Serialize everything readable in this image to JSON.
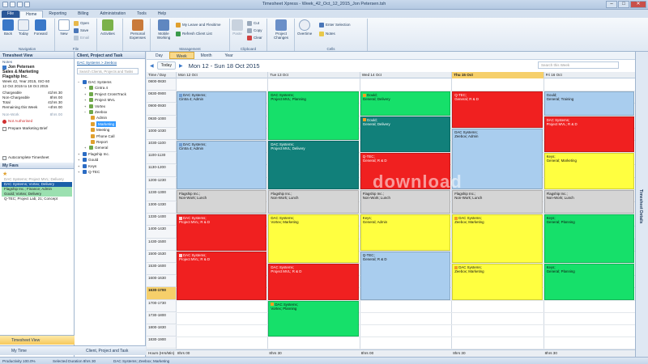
{
  "window": {
    "title": "Timesheet Xpress - Week_42_Oct_12_2015_Jon Petersen.tsh"
  },
  "tabs": [
    "File",
    "Home",
    "Reporting",
    "Billing",
    "Administration",
    "Tools",
    "Help"
  ],
  "ribbon": {
    "navigation": {
      "label": "Navigation",
      "back": "Back",
      "today": "Today",
      "forward": "Forward"
    },
    "file": {
      "label": "File",
      "new": "New",
      "open": "Open",
      "save": "Save",
      "email": "Email"
    },
    "activities": "Activities",
    "personal": "Personal Expenses",
    "management": {
      "label": "Management",
      "mobile": "Mobile Working",
      "leave": "My Leave and Flexitime",
      "refresh": "Refresh Client List"
    },
    "clipboard": {
      "label": "Clipboard",
      "paste": "Paste",
      "cut": "Cut",
      "copy": "Copy",
      "clear": "Clear"
    },
    "project_changes": "Project Changes",
    "cells": {
      "label": "Cells",
      "overtime": "Overtime",
      "enter_selection": "Enter Selection",
      "notes": "Notes"
    }
  },
  "timesheet_view": {
    "title": "Timesheet View",
    "notes_label": "Notes",
    "user": "Jon Petersen",
    "dept1": "Sales & Marketing",
    "dept2": "Flagship Inc.",
    "week_line1": "Week 42, Year 2015, ISO 60",
    "week_line2": "12 Oct 2015 to 18 Oct 2015",
    "stats": [
      {
        "k": "Chargeable",
        "v": "41hrs 30"
      },
      {
        "k": "Non-Chargeable",
        "v": "8hrs 00"
      },
      {
        "k": "Total",
        "v": "41hrs 30"
      },
      {
        "k": "Remaining this Week",
        "v": "+4hrs 00"
      }
    ],
    "nonwork": {
      "k": "Non-Work",
      "v": "8hrs 00"
    },
    "not_authorised": "Not Authorised",
    "prepare": "Prepare Marketing Brief",
    "autocomplete": "Autocomplete Timesheet",
    "my_favs": "My Favs",
    "favs": [
      "DAC Systems; Project MVL; Delivery",
      "DAC Systems; Vortex; Delivery",
      "Flagship Inc.; Finance; Admin",
      "Gould; Vortex; Delivery",
      "Q-TEC; Project Lab; 21; Concept"
    ],
    "btn_timesheet": "Timesheet View",
    "btn_mytime": "My Time"
  },
  "cpt": {
    "title": "Client, Project and Task",
    "crumb": "DAC Systems > Zeebox",
    "search_placeholder": "Search Clients, Projects and Tasks",
    "nodes": [
      "DAC Systems",
      "Cintra 4",
      "Project CrossTrack",
      "Project MVL",
      "Vortex",
      "Zeebox",
      "Admin",
      "Marketing",
      "Meeting",
      "Phone Call",
      "Report",
      "General",
      "Flagship Inc.",
      "Gould",
      "Keys",
      "Q-TEC"
    ],
    "btn": "Client, Project and Task"
  },
  "calendar": {
    "view_tabs": [
      "Day",
      "Week",
      "Month",
      "Year"
    ],
    "today_btn": "Today",
    "range": "Mon 12 - Sun 18 Oct 2015",
    "search_placeholder": "Search this Week",
    "time_header": "Time / Day",
    "days": [
      "Mon 12 Oct",
      "Tue 13 Oct",
      "Wed 14 Oct",
      "Thu 15 Oct",
      "Fri 16 Oct"
    ],
    "times": [
      "0800-0830",
      "0830-0900",
      "0900-0930",
      "0930-1000",
      "1000-1030",
      "1030-1100",
      "1100-1130",
      "1130-1200",
      "1200-1230",
      "1230-1300",
      "1300-1330",
      "1330-1400",
      "1400-1430",
      "1430-1500",
      "1500-1530",
      "1530-1600",
      "1600-1630",
      "1630-1700",
      "1700-1730",
      "1730-1800",
      "1800-1830",
      "1830-1900"
    ],
    "current_time_index": 17,
    "totals_label": "Hours (Hrs/Min)",
    "totals": [
      "8hrs 00",
      "8hrs 30",
      "8hrs 00",
      "8hrs 30",
      "8hrs 30"
    ],
    "events": [
      {
        "d": 0,
        "s": 1,
        "e": 5,
        "c": "#a9cdee",
        "l": [
          "DAC Systems;",
          "Cintra 4; Admin"
        ],
        "b": "#6f9bd0"
      },
      {
        "d": 0,
        "s": 5,
        "e": 9,
        "c": "#a9cdee",
        "l": [
          "DAC Systems;",
          "Cintra 4; Admin"
        ],
        "b": "#6f9bd0"
      },
      {
        "d": 0,
        "s": 9,
        "e": 11,
        "c": "#d5d5d5",
        "l": [
          "Flagship Inc.;",
          "Non-Work; Lunch"
        ]
      },
      {
        "d": 0,
        "s": 11,
        "e": 14,
        "c": "#f02020",
        "l": [
          "DAC Systems;",
          "Project MVL; R & D"
        ],
        "b": "#ffd0d0",
        "w": 1
      },
      {
        "d": 0,
        "s": 14,
        "e": 18,
        "c": "#f02020",
        "l": [
          "DAC Systems;",
          "Project MVL; R & D"
        ],
        "b": "#ffd0d0",
        "w": 1
      },
      {
        "d": 1,
        "s": 1,
        "e": 5,
        "c": "#16e06a",
        "l": [
          "DAC Systems;",
          "Project MVL; Planning"
        ]
      },
      {
        "d": 1,
        "s": 5,
        "e": 9,
        "c": "#11807a",
        "l": [
          "DAC Systems;",
          "Project MVL; Delivery"
        ],
        "w": 1
      },
      {
        "d": 1,
        "s": 9,
        "e": 11,
        "c": "#d5d5d5",
        "l": [
          "Flagship Inc.;",
          "Non-Work; Lunch"
        ]
      },
      {
        "d": 1,
        "s": 11,
        "e": 15,
        "c": "#ffff40",
        "l": [
          "DAC Systems;",
          "Vortex; Marketing"
        ]
      },
      {
        "d": 1,
        "s": 15,
        "e": 18,
        "c": "#f02020",
        "l": [
          "DAC Systems;",
          "Project MVL; R & D"
        ],
        "w": 1
      },
      {
        "d": 1,
        "s": 18,
        "e": 21,
        "c": "#16e06a",
        "l": [
          "DAC Systems;",
          "Vortex; Planning"
        ],
        "b": "#f0a020"
      },
      {
        "d": 2,
        "s": 1,
        "e": 3,
        "c": "#16e06a",
        "l": [
          "Gould;",
          "General; Delivery"
        ],
        "b": "#f0a020"
      },
      {
        "d": 2,
        "s": 3,
        "e": 6,
        "c": "#11807a",
        "l": [
          "Gould;",
          "General; Delivery"
        ],
        "b": "#f0a020",
        "w": 1
      },
      {
        "d": 2,
        "s": 6,
        "e": 9,
        "c": "#f02020",
        "l": [
          "Q-TEC;",
          "General; R & D"
        ],
        "w": 1
      },
      {
        "d": 2,
        "s": 9,
        "e": 11,
        "c": "#d5d5d5",
        "l": [
          "Flagship Inc.;",
          "Non-Work; Lunch"
        ]
      },
      {
        "d": 2,
        "s": 11,
        "e": 14,
        "c": "#ffff40",
        "l": [
          "Keys;",
          "General; Admin"
        ]
      },
      {
        "d": 2,
        "s": 14,
        "e": 18,
        "c": "#a9cdee",
        "l": [
          "Q-TEC;",
          "General; R & D"
        ]
      },
      {
        "d": 3,
        "s": 1,
        "e": 4,
        "c": "#f02020",
        "l": [
          "Q-TEC;",
          "General; R & D"
        ],
        "w": 1
      },
      {
        "d": 3,
        "s": 4,
        "e": 9,
        "c": "#a9cdee",
        "l": [
          "DAC Systems;",
          "Zeebox; Admin"
        ]
      },
      {
        "d": 3,
        "s": 9,
        "e": 11,
        "c": "#d5d5d5",
        "l": [
          "Flagship Inc.;",
          "Non-Work; Lunch"
        ]
      },
      {
        "d": 3,
        "s": 11,
        "e": 15,
        "c": "#ffff40",
        "l": [
          "DAC Systems;",
          "Zeebox; Marketing"
        ],
        "b": "#f0a020"
      },
      {
        "d": 3,
        "s": 15,
        "e": 18,
        "c": "#ffff40",
        "l": [
          "DAC Systems;",
          "Zeebox; Marketing"
        ],
        "b": "#f0a020"
      },
      {
        "d": 4,
        "s": 1,
        "e": 3,
        "c": "#a9cdee",
        "l": [
          "Gould;",
          "General; Training"
        ]
      },
      {
        "d": 4,
        "s": 3,
        "e": 6,
        "c": "#f02020",
        "l": [
          "DAC Systems;",
          "Project MVL; R & D"
        ],
        "w": 1
      },
      {
        "d": 4,
        "s": 6,
        "e": 9,
        "c": "#ffff40",
        "l": [
          "Keys;",
          "General; Marketing"
        ]
      },
      {
        "d": 4,
        "s": 9,
        "e": 11,
        "c": "#d5d5d5",
        "l": [
          "Flagship Inc.;",
          "Non-Work; Lunch"
        ]
      },
      {
        "d": 4,
        "s": 11,
        "e": 15,
        "c": "#16e06a",
        "l": [
          "Keys;",
          "General; Planning"
        ]
      },
      {
        "d": 4,
        "s": 15,
        "e": 18,
        "c": "#16e06a",
        "l": [
          "Keys;",
          "General; Planning"
        ]
      }
    ]
  },
  "right_pane": "Timesheet Details",
  "status": {
    "productivity": "Productivity 100.0%",
    "duration": "Selected Duration 8hrs 30",
    "task": "DAC Systems; Zeebox; Marketing"
  },
  "watermark": "download"
}
